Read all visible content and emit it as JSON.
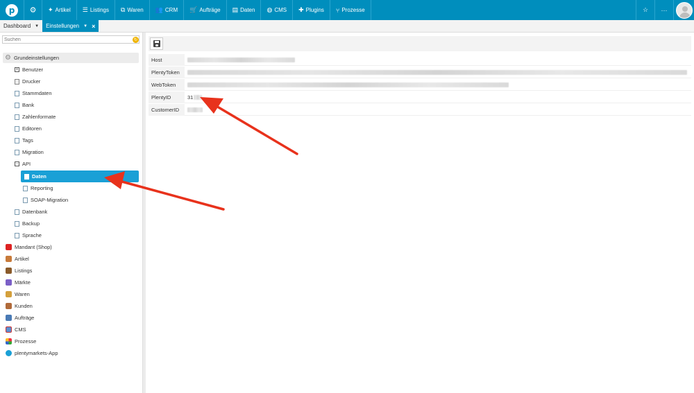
{
  "topnav": {
    "items": [
      {
        "label": "Artikel",
        "icon": "tag-icon"
      },
      {
        "label": "Listings",
        "icon": "list-icon"
      },
      {
        "label": "Waren",
        "icon": "boxes-icon"
      },
      {
        "label": "CRM",
        "icon": "people-icon"
      },
      {
        "label": "Aufträge",
        "icon": "cart-icon"
      },
      {
        "label": "Daten",
        "icon": "database-icon"
      },
      {
        "label": "CMS",
        "icon": "globe-icon"
      },
      {
        "label": "Plugins",
        "icon": "puzzle-icon"
      },
      {
        "label": "Prozesse",
        "icon": "process-icon"
      }
    ],
    "star": "☆",
    "more": "···"
  },
  "tabs": {
    "dashboard": "Dashboard",
    "settings": "Einstellungen",
    "close": "×"
  },
  "sidebar": {
    "search_placeholder": "Suchen",
    "root": "Grundeinstellungen",
    "items": {
      "benutzer": "Benutzer",
      "drucker": "Drucker",
      "stammdaten": "Stammdaten",
      "bank": "Bank",
      "zahlenformate": "Zahlenformate",
      "editoren": "Editoren",
      "tags": "Tags",
      "migration": "Migration",
      "api": "API",
      "daten": "Daten",
      "reporting": "Reporting",
      "soap": "SOAP-Migration",
      "datenbank": "Datenbank",
      "backup": "Backup",
      "sprache": "Sprache"
    },
    "apps": {
      "mandant": "Mandant (Shop)",
      "artikel": "Artikel",
      "listings": "Listings",
      "maerkte": "Märkte",
      "waren": "Waren",
      "kunden": "Kunden",
      "auftraege": "Aufträge",
      "cms": "CMS",
      "prozesse": "Prozesse",
      "app": "plentymarkets-App"
    }
  },
  "form": {
    "host_label": "Host",
    "plentytoken_label": "PlentyToken",
    "webtoken_label": "WebToken",
    "plentyid_label": "PlentyID",
    "plentyid_value": "31",
    "customerid_label": "CustomerID"
  },
  "colors": {
    "brand": "#008ebd",
    "selected": "#1aa0d6",
    "arrow": "#e8321c"
  }
}
